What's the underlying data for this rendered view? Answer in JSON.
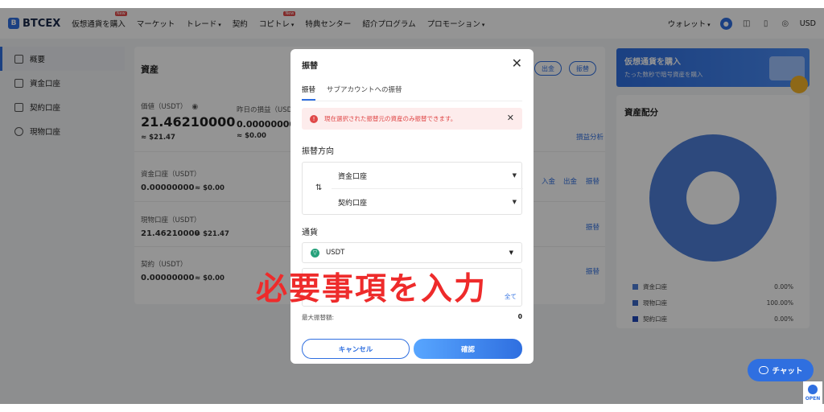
{
  "header": {
    "logo": "BTCEX",
    "nav": [
      {
        "label": "仮想通貨を購入",
        "badge": "New"
      },
      {
        "label": "マーケット"
      },
      {
        "label": "トレード",
        "caret": "▾"
      },
      {
        "label": "契約"
      },
      {
        "label": "コピトレ",
        "badge": "New",
        "caret": "▾"
      },
      {
        "label": "特典センター"
      },
      {
        "label": "紹介プログラム"
      },
      {
        "label": "プロモーション",
        "caret": "▾"
      }
    ],
    "wallet": "ウォレット",
    "currency": "USD"
  },
  "sidebar": {
    "items": [
      {
        "label": "概要"
      },
      {
        "label": "資金口座"
      },
      {
        "label": "契約口座"
      },
      {
        "label": "現物口座"
      }
    ]
  },
  "main": {
    "title": "資産",
    "withdraw_btn": "出金",
    "transfer_btn": "振替",
    "valuation_label": "価値（USDT）",
    "valuation_value": "21.46210000",
    "valuation_usd": "≈ $21.47",
    "pnl_label": "昨日の損益（USD",
    "pnl_value": "0.00000000",
    "pnl_usd": "≈ $0.00",
    "pnl_analysis": "損益分析",
    "accounts": [
      {
        "label": "資金口座（USDT）",
        "value": "0.00000000",
        "usd": "≈ $0.00",
        "actions": [
          "入金",
          "出金",
          "振替"
        ]
      },
      {
        "label": "現物口座（USDT）",
        "value": "21.46210000",
        "usd": "≈ $21.47",
        "actions": [
          "振替"
        ]
      },
      {
        "label": "契約（USDT）",
        "value": "0.00000000",
        "usd": "≈ $0.00",
        "actions": [
          "振替"
        ]
      }
    ]
  },
  "banner": {
    "title": "仮想通貨を購入",
    "subtitle": "たった数秒で暗号資産を購入"
  },
  "distribution": {
    "title": "資産配分",
    "colors": {
      "ring": "#4f7fd8",
      "hole": "#ffffff"
    },
    "legend": [
      {
        "label": "資金口座",
        "pct": "0.00%",
        "color": "#4f7fd8"
      },
      {
        "label": "現物口座",
        "pct": "100.00%",
        "color": "#3a67c4"
      },
      {
        "label": "契約口座",
        "pct": "0.00%",
        "color": "#1f47b8"
      }
    ]
  },
  "chat": {
    "label": "チャット"
  },
  "open_widget": {
    "label": "OPEN"
  },
  "modal": {
    "title": "振替",
    "tabs": [
      "振替",
      "サブアカウントへの振替"
    ],
    "alert": "現在選択された振替元の資産のみ振替できます。",
    "direction_label": "振替方向",
    "from_account": "資金口座",
    "to_account": "契約口座",
    "currency_label": "通貨",
    "currency_value": "USDT",
    "all_label": "全て",
    "max_label": "最大振替額:",
    "max_value": "0",
    "cancel": "キャンセル",
    "confirm": "確認"
  },
  "caption": "必要事項を入力",
  "accent_color": "#2f6fe0"
}
